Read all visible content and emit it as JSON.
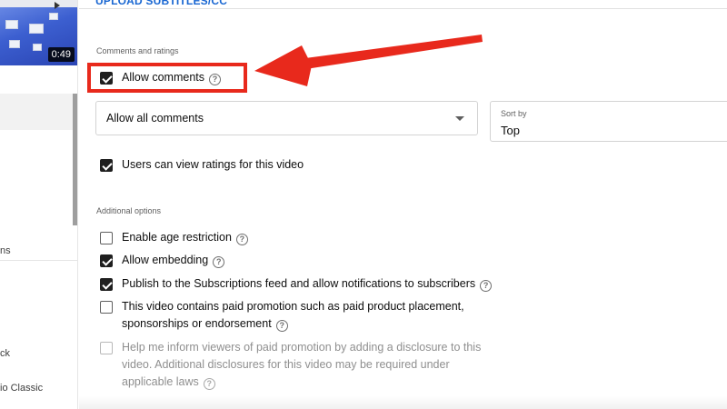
{
  "thumbnail": {
    "duration": "0:49"
  },
  "sidebar": {
    "fragments": [
      {
        "text": "ns"
      },
      {
        "text": "ck"
      },
      {
        "text": "io Classic"
      }
    ]
  },
  "main": {
    "upload_link": "UPLOAD SUBTITLES/CC",
    "comments_section": {
      "label": "Comments and ratings",
      "allow_comments": {
        "label": "Allow comments",
        "checked": true
      },
      "comment_filter": {
        "value": "Allow all comments"
      },
      "sort_by": {
        "label": "Sort by",
        "value": "Top"
      },
      "view_ratings": {
        "label": "Users can view ratings for this video",
        "checked": true
      }
    },
    "additional_section": {
      "label": "Additional options",
      "options": [
        {
          "label": "Enable age restriction",
          "checked": false
        },
        {
          "label": "Allow embedding",
          "checked": true
        },
        {
          "label": "Publish to the Subscriptions feed and allow notifications to subscribers",
          "checked": true
        },
        {
          "label": "This video contains paid promotion such as paid product placement, sponsorships or endorsement",
          "checked": false
        },
        {
          "label": "Help me inform viewers of paid promotion by adding a disclosure to this video. Additional disclosures for this video may be required under applicable laws",
          "checked": false,
          "disabled": true
        }
      ]
    }
  },
  "annotation": {
    "color": "#e8291c"
  },
  "icons": {
    "help": "help-circle-icon",
    "caret": "caret-down-icon"
  }
}
